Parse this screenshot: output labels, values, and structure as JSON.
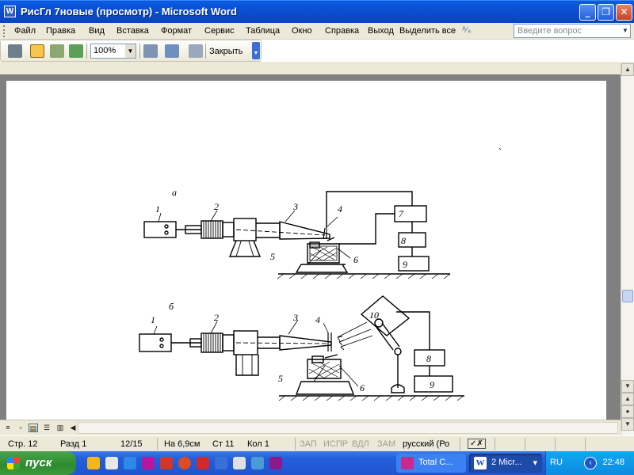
{
  "window": {
    "title": "РисГл 7новые (просмотр) - Microsoft Word",
    "app_icon": "W",
    "min_icon": "_",
    "max_icon": "❐",
    "close_icon": "✕"
  },
  "menu": {
    "items": [
      "Файл",
      "Правка",
      "Вид",
      "Вставка",
      "Формат",
      "Сервис",
      "Таблица",
      "Окно",
      "Справка",
      "Выход",
      "Выделить все"
    ],
    "ask_placeholder": "Введите вопрос"
  },
  "toolbar": {
    "zoom": "100%",
    "close_label": "Закрыть"
  },
  "figure": {
    "label_a": "а",
    "label_b": "б",
    "num_1": "1",
    "num_2": "2",
    "num_3": "3",
    "num_4": "4",
    "num_5": "5",
    "num_6": "6",
    "num_7": "7",
    "num_8": "8",
    "num_9": "9",
    "num_10": "10"
  },
  "status": {
    "page": "Стр. 12",
    "section": "Разд 1",
    "pages": "12/15",
    "at": "На 6,9см",
    "line": "Ст 11",
    "col": "Кол 1",
    "rec": "ЗАП",
    "trk": "ИСПР",
    "ext": "ВДЛ",
    "ovr": "ЗАМ",
    "language": "русский (Ро"
  },
  "taskbar": {
    "start_label": "пуск",
    "tasks": [
      "Total C...",
      "2 Micr..."
    ],
    "task_more": "▾",
    "language": "RU",
    "clock": "22:48"
  },
  "colors": {
    "titlebar": "#0a4fd1",
    "chrome": "#ece9d8",
    "taskbar": "#245edc",
    "start": "#2f8a2f",
    "workspace": "#808080"
  }
}
